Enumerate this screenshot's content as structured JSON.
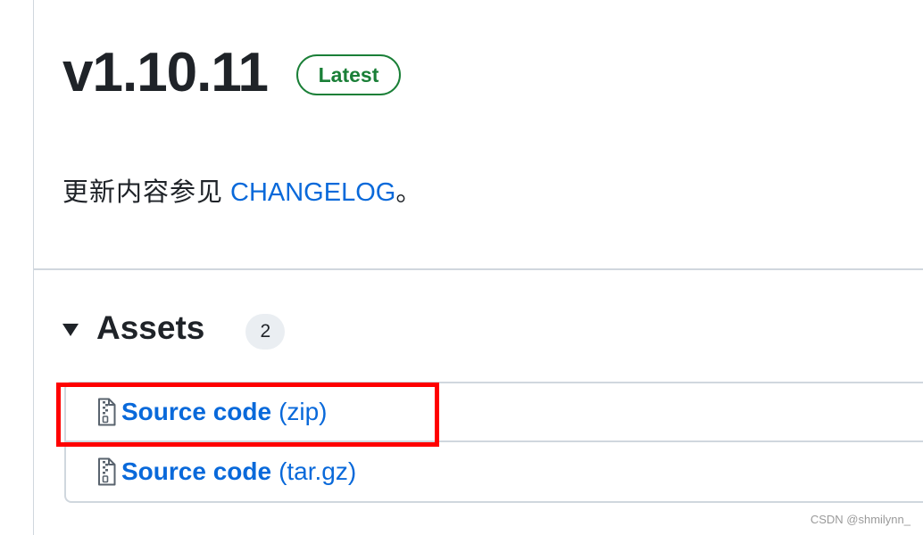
{
  "release": {
    "version": "v1.10.11",
    "badge": "Latest",
    "notes_text": "更新内容参见",
    "notes_link": "CHANGELOG",
    "notes_suffix": "。"
  },
  "assets": {
    "title": "Assets",
    "count": "2",
    "items": [
      {
        "name": "Source code",
        "ext": "(zip)",
        "icon": "file-zip-icon"
      },
      {
        "name": "Source code",
        "ext": "(tar.gz)",
        "icon": "file-zip-icon"
      }
    ]
  },
  "annotation": {
    "color": "#ff0000"
  },
  "watermark": "CSDN @shmilynn_",
  "colors": {
    "link": "#0969da",
    "success": "#1a7f37",
    "border": "#d0d7de"
  }
}
